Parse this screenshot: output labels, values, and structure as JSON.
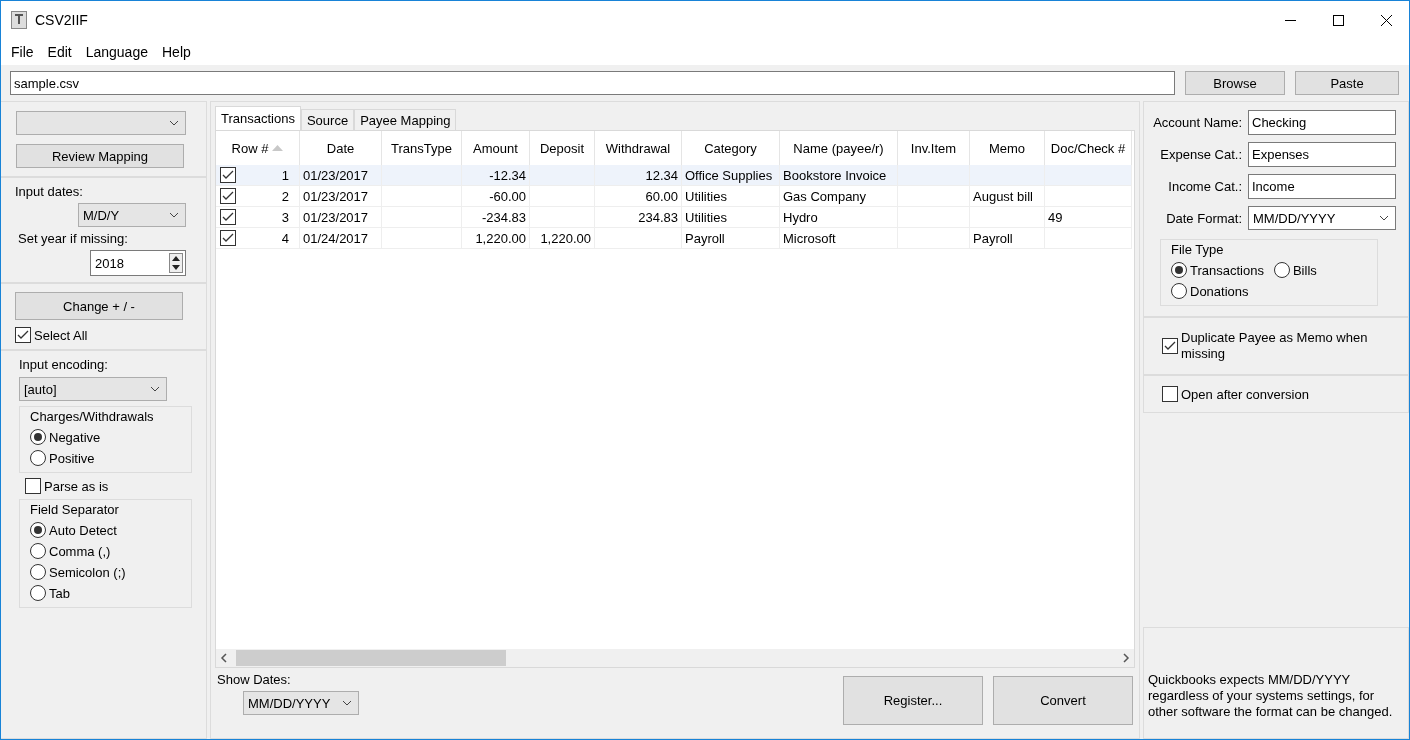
{
  "window": {
    "title": "CSV2IIF"
  },
  "menu": [
    "File",
    "Edit",
    "Language",
    "Help"
  ],
  "file_path": {
    "value": "sample.csv"
  },
  "top_buttons": [
    "Browse",
    "Paste"
  ],
  "left_panel": {
    "review_button": "Review Mapping",
    "input_dates_label": "Input dates:",
    "input_dates_select": {
      "value": "M/D/Y"
    },
    "year_label": "Set year if missing:",
    "year_field": {
      "value": "2018"
    },
    "change_button": "Change + / -",
    "select_all": {
      "label": "Select All",
      "checked": true
    },
    "encoding_label": "Input encoding:",
    "encoding_select": {
      "value": "[auto]"
    },
    "charges_group": {
      "title": "Charges/Withdrawals",
      "options": [
        {
          "label": "Negative",
          "selected": true
        },
        {
          "label": "Positive",
          "selected": false
        }
      ]
    },
    "parse_as_is": {
      "label": "Parse as is",
      "checked": false
    },
    "separator_group": {
      "title": "Field Separator",
      "options": [
        {
          "label": "Auto Detect",
          "selected": true
        },
        {
          "label": "Comma (,)",
          "selected": false
        },
        {
          "label": "Semicolon (;)",
          "selected": false
        },
        {
          "label": "Tab",
          "selected": false
        }
      ]
    }
  },
  "tabs": [
    {
      "label": "Transactions",
      "selected": true
    },
    {
      "label": "Source",
      "selected": false
    },
    {
      "label": "Payee Mapping",
      "selected": false
    }
  ],
  "table": {
    "columns": [
      "Row #",
      "Date",
      "TransType",
      "Amount",
      "Deposit",
      "Withdrawal",
      "Category",
      "Name (payee/r)",
      "Inv.Item",
      "Memo",
      "Doc/Check #"
    ],
    "rows": [
      {
        "checked": true,
        "selected": true,
        "cells": [
          "1",
          "01/23/2017",
          "",
          "-12.34",
          "",
          "12.34",
          "Office Supplies",
          "Bookstore Invoice",
          "",
          "",
          ""
        ]
      },
      {
        "checked": true,
        "selected": false,
        "cells": [
          "2",
          "01/23/2017",
          "",
          "-60.00",
          "",
          "60.00",
          "Utilities",
          "Gas Company",
          "",
          "August bill",
          ""
        ]
      },
      {
        "checked": true,
        "selected": false,
        "cells": [
          "3",
          "01/23/2017",
          "",
          "-234.83",
          "",
          "234.83",
          "Utilities",
          "Hydro",
          "",
          "",
          "49"
        ]
      },
      {
        "checked": true,
        "selected": false,
        "cells": [
          "4",
          "01/24/2017",
          "",
          "1,220.00",
          "1,220.00",
          "",
          "Payroll",
          "Microsoft",
          "",
          "Payroll",
          ""
        ]
      }
    ]
  },
  "show_dates": {
    "label": "Show Dates:",
    "value": "MM/DD/YYYY"
  },
  "bottom_buttons": [
    "Register...",
    "Convert"
  ],
  "right_panel": {
    "fields": [
      {
        "label": "Account Name:",
        "value": "Checking",
        "kind": "text"
      },
      {
        "label": "Expense Cat.:",
        "value": "Expenses",
        "kind": "text"
      },
      {
        "label": "Income Cat.:",
        "value": "Income",
        "kind": "text"
      },
      {
        "label": "Date Format:",
        "value": "MM/DD/YYYY",
        "kind": "select"
      }
    ],
    "file_type": {
      "title": "File Type",
      "options": [
        {
          "label": "Transactions",
          "selected": true
        },
        {
          "label": "Bills",
          "selected": false
        },
        {
          "label": "Donations",
          "selected": false
        }
      ]
    },
    "duplicate_payee": {
      "label": "Duplicate Payee as Memo when missing",
      "checked": true
    },
    "open_after": {
      "label": "Open after conversion",
      "checked": false
    },
    "note": "Quickbooks expects MM/DD/YYYY regardless of your systems settings, for other software the format can be changed."
  }
}
